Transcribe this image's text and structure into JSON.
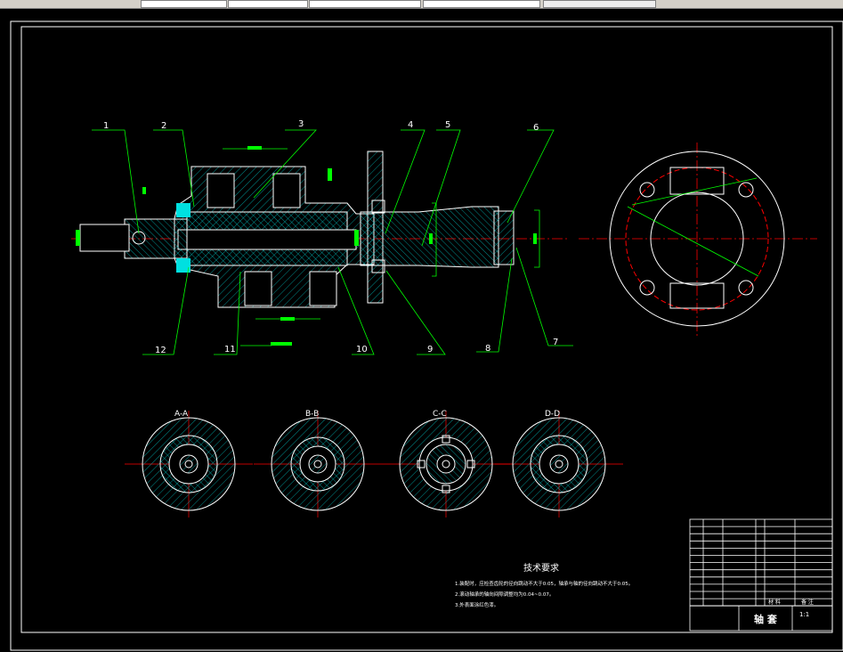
{
  "toolbar": {
    "fields": [
      "",
      "",
      "",
      ""
    ]
  },
  "drawing": {
    "part_labels": [
      "1",
      "2",
      "3",
      "4",
      "5",
      "6",
      "7",
      "8",
      "9",
      "10",
      "11",
      "12"
    ],
    "sections": [
      "A-A",
      "B-B",
      "C-C",
      "D-D"
    ],
    "tech_requirements": {
      "title": "技术要求",
      "items": [
        "1.装配时，应检查齿轮的径向跳动不大于0.05，轴承与轴的径向跳动不大于0.05。",
        "2.滚动轴承的轴向间隙调整均为0.04~0.07。",
        "3.外表面涂红色漆。"
      ]
    },
    "title_block": {
      "material_header": "材 料",
      "remark_header": "备 注",
      "part_name": "轴 套",
      "scale": "1:1"
    },
    "colors": {
      "background": "#000000",
      "outline": "#ffffff",
      "leader": "#00ff00",
      "centerline": "#ff0000",
      "hatch": "#00ffff"
    }
  }
}
